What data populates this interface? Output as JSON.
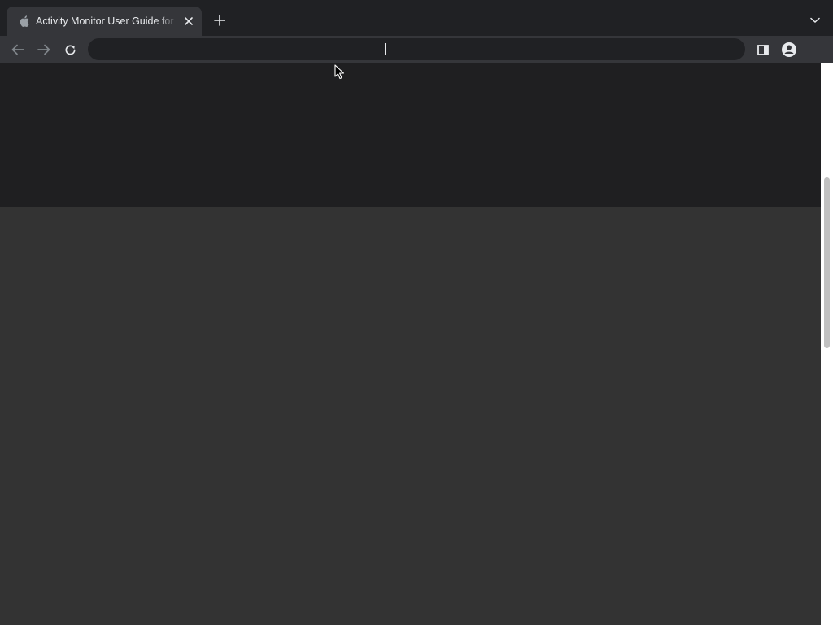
{
  "browser": {
    "tab": {
      "title": "Activity Monitor User Guide for Mac - Apple Support",
      "favicon": "apple-logo-icon"
    },
    "toolbar": {
      "back_icon": "back-arrow-icon",
      "forward_icon": "forward-arrow-icon",
      "reload_icon": "reload-icon",
      "omnibox": {
        "value": "",
        "placeholder": ""
      },
      "side_panel_icon": "side-panel-icon",
      "profile_icon": "profile-icon"
    },
    "new_tab_icon": "plus-icon",
    "tab_search_icon": "chevron-down-icon"
  },
  "colors": {
    "tab_strip": "#202124",
    "toolbar": "#35363a",
    "omnibox": "#202124",
    "page_header": "#1f1f21",
    "page_body": "#333333",
    "scrollbar_track": "#ffffff",
    "scrollbar_thumb": "#c1c1c1"
  }
}
